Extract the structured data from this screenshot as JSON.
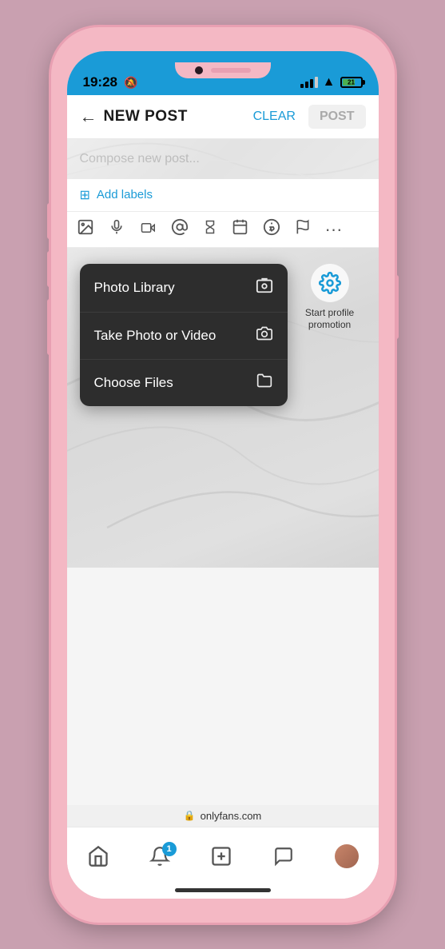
{
  "phone": {
    "status_bar": {
      "time": "19:28",
      "bell_icon": "🔔",
      "battery_label": "21"
    },
    "header": {
      "back_label": "←",
      "title": "NEW POST",
      "clear_label": "CLEAR",
      "post_label": "POST"
    },
    "editor": {
      "placeholder": "Compose new post..."
    },
    "labels": {
      "icon": "⊞",
      "label": "Add labels"
    },
    "toolbar": {
      "icons": [
        "🖼",
        "🎤",
        "🎬",
        "@",
        "⏳",
        "📅",
        "💲",
        "🚩",
        "•••"
      ]
    },
    "dropdown": {
      "items": [
        {
          "label": "Photo Library",
          "icon": "photo-library-icon"
        },
        {
          "label": "Take Photo or Video",
          "icon": "camera-icon"
        },
        {
          "label": "Choose Files",
          "icon": "folder-icon"
        }
      ]
    },
    "profile_promo": {
      "icon": "⚙",
      "text": "Start profile promotion"
    },
    "bottom_nav": {
      "items": [
        {
          "icon": "home",
          "label": "Home",
          "badge": null
        },
        {
          "icon": "bell",
          "label": "Notifications",
          "badge": "1"
        },
        {
          "icon": "plus-square",
          "label": "New Post",
          "badge": null
        },
        {
          "icon": "chat",
          "label": "Messages",
          "badge": null
        },
        {
          "icon": "avatar",
          "label": "Profile",
          "badge": null
        }
      ]
    },
    "url_bar": {
      "lock": "🔒",
      "url": "onlyfans.com"
    }
  }
}
